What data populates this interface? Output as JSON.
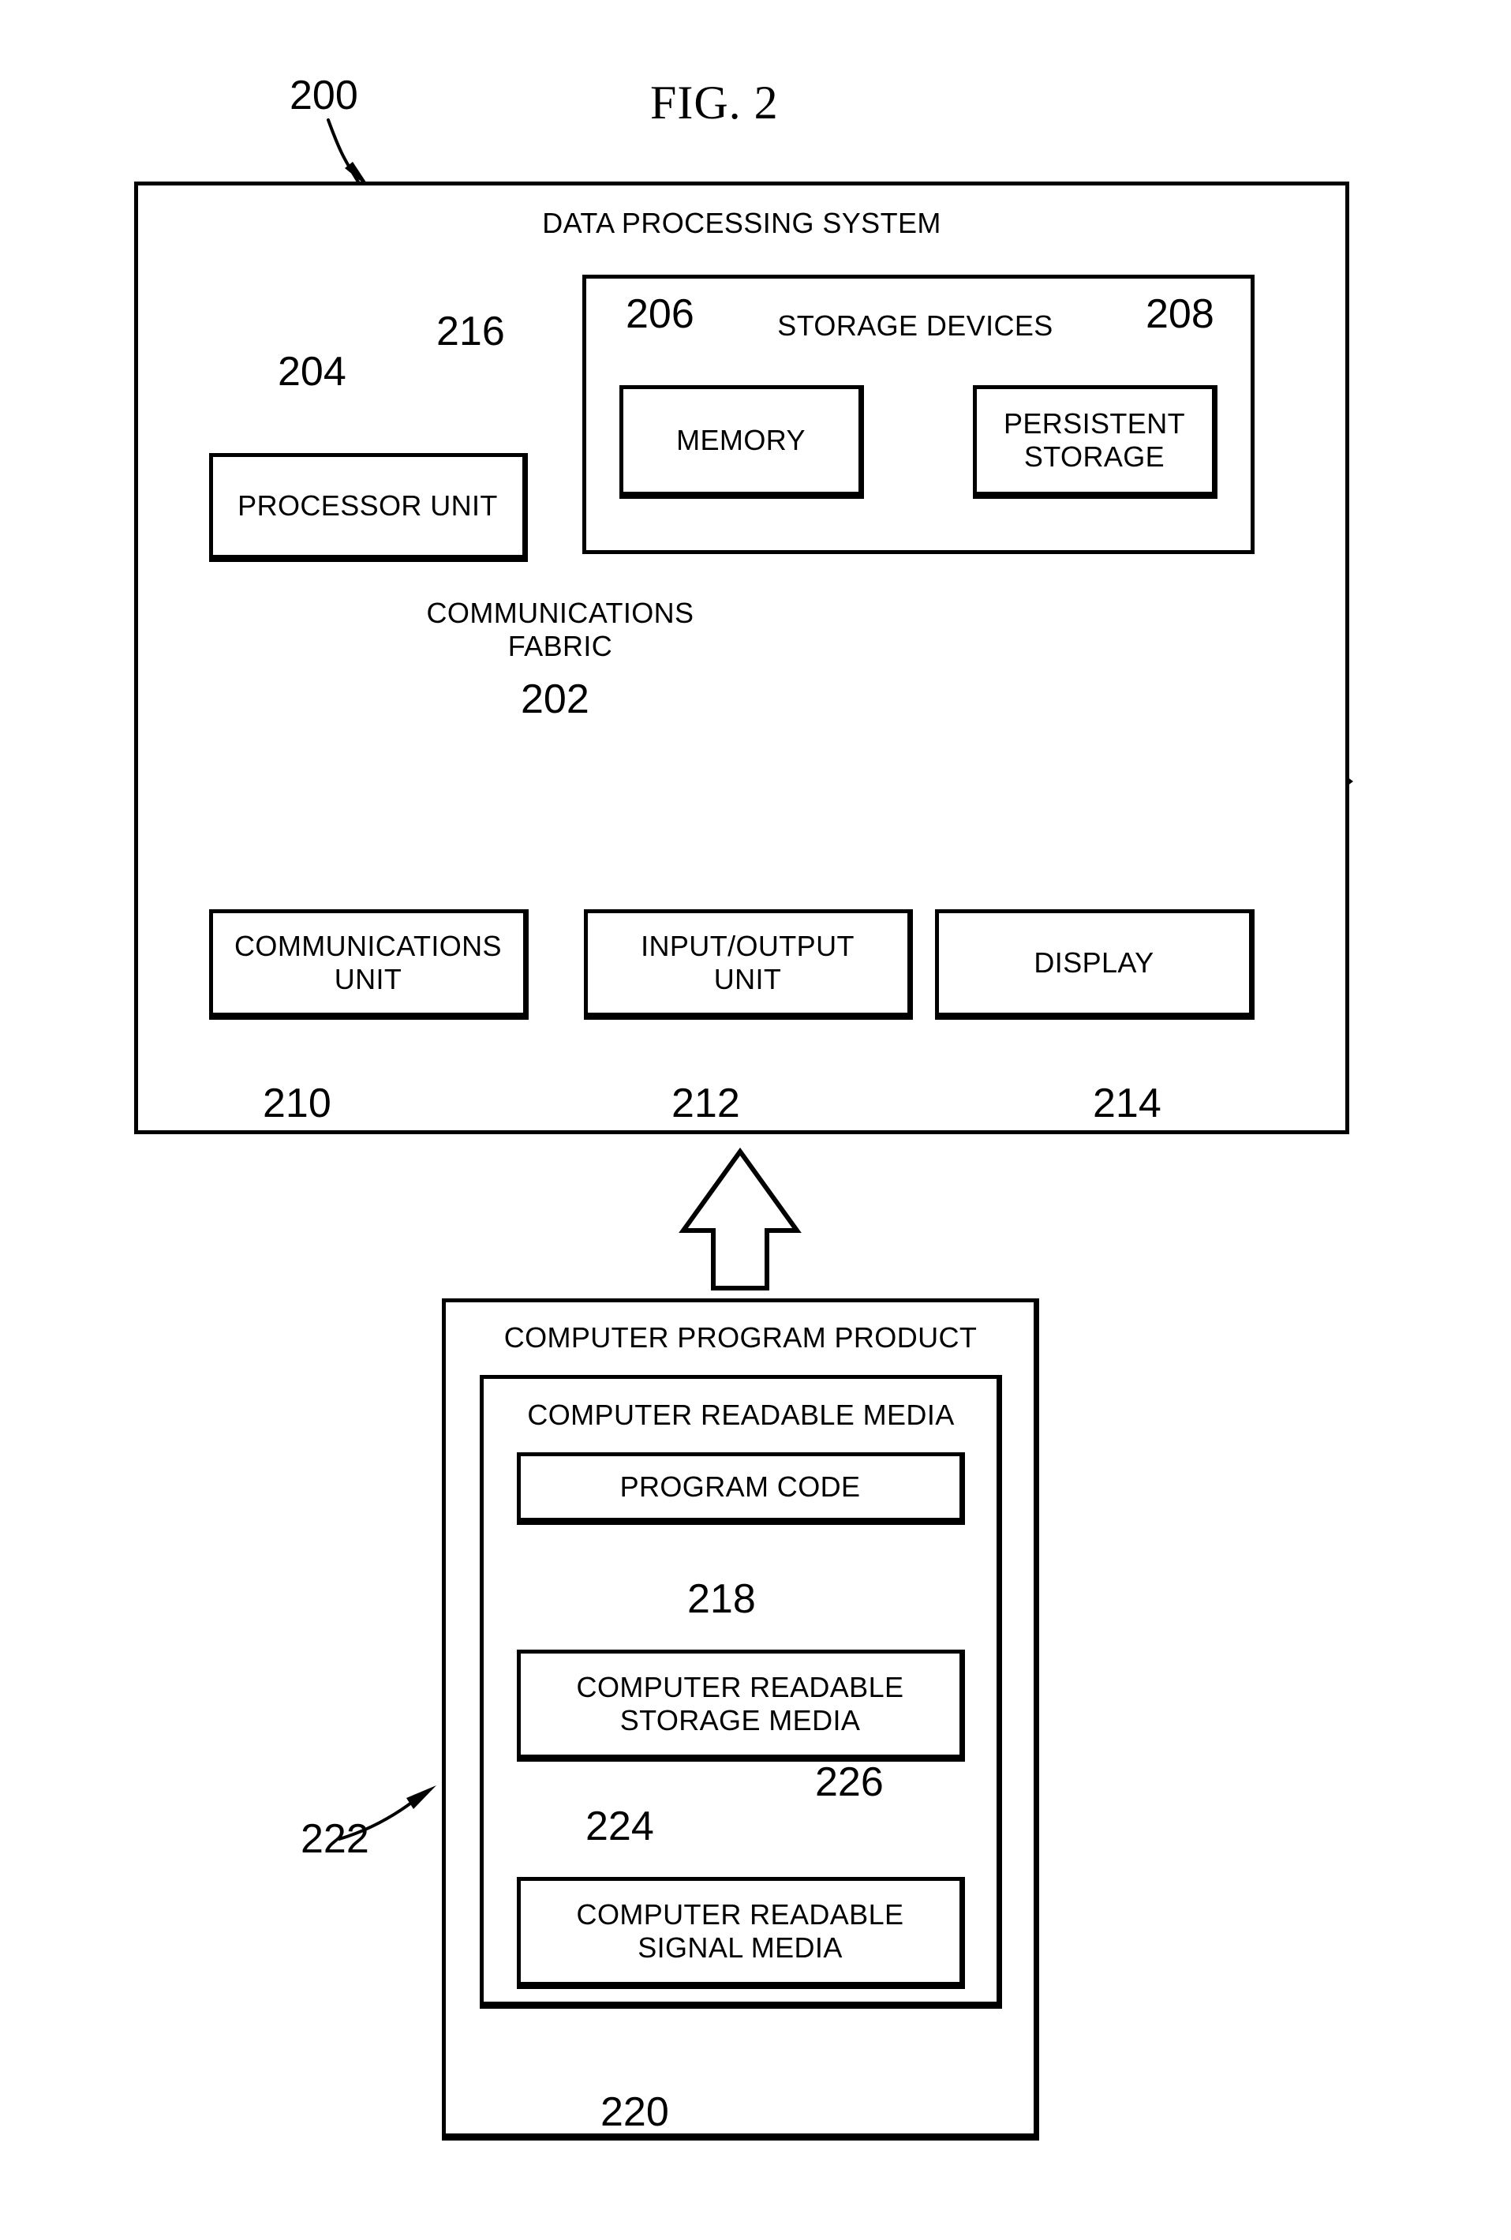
{
  "figure": {
    "title": "FIG. 2",
    "system_ref": "200"
  },
  "data_processing_system": {
    "label": "DATA PROCESSING SYSTEM",
    "ref": "200",
    "processor_unit": {
      "label": "PROCESSOR UNIT",
      "ref": "204"
    },
    "communications_fabric": {
      "label": "COMMUNICATIONS\nFABRIC",
      "ref": "202"
    },
    "storage_devices": {
      "label": "STORAGE DEVICES",
      "ref": "216",
      "memory": {
        "label": "MEMORY",
        "ref": "206"
      },
      "persistent_storage": {
        "label": "PERSISTENT\nSTORAGE",
        "ref": "208"
      }
    },
    "communications_unit": {
      "label": "COMMUNICATIONS\nUNIT",
      "ref": "210"
    },
    "input_output_unit": {
      "label": "INPUT/OUTPUT\nUNIT",
      "ref": "212"
    },
    "display": {
      "label": "DISPLAY",
      "ref": "214"
    }
  },
  "computer_program_product": {
    "label": "COMPUTER PROGRAM PRODUCT",
    "ref": "222",
    "computer_readable_media": {
      "label": "COMPUTER READABLE MEDIA",
      "ref": "220",
      "program_code": {
        "label": "PROGRAM CODE",
        "ref": "218"
      },
      "computer_readable_storage_media": {
        "label": "COMPUTER READABLE\nSTORAGE MEDIA",
        "ref": "224"
      },
      "computer_readable_signal_media": {
        "label": "COMPUTER READABLE\nSIGNAL MEDIA",
        "ref": "226"
      }
    }
  },
  "colors": {
    "ink": "#000000",
    "paper": "#ffffff"
  }
}
